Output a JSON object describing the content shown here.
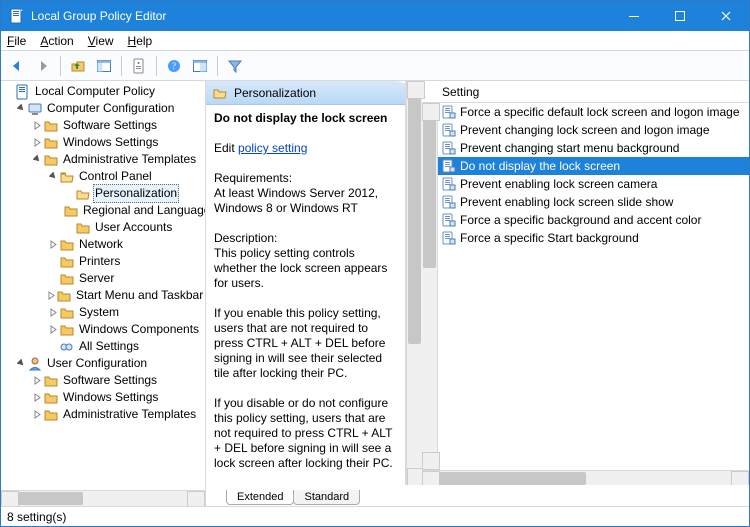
{
  "window": {
    "title": "Local Group Policy Editor"
  },
  "menubar": {
    "file": "File",
    "action": "Action",
    "view": "View",
    "help": "Help"
  },
  "tree": {
    "root": "Local Computer Policy",
    "cc": "Computer Configuration",
    "cc_sw": "Software Settings",
    "cc_win": "Windows Settings",
    "cc_at": "Administrative Templates",
    "cp": "Control Panel",
    "cp_pers": "Personalization",
    "cp_reg": "Regional and Language Options",
    "cp_ua": "User Accounts",
    "net": "Network",
    "prn": "Printers",
    "srv": "Server",
    "sm": "Start Menu and Taskbar",
    "sys": "System",
    "wc": "Windows Components",
    "alls": "All Settings",
    "uc": "User Configuration",
    "uc_sw": "Software Settings",
    "uc_win": "Windows Settings",
    "uc_at": "Administrative Templates"
  },
  "detail": {
    "heading": "Personalization",
    "title": "Do not display the lock screen",
    "edit_prefix": "Edit ",
    "edit_link": "policy setting",
    "req_label": "Requirements:",
    "req_text": "At least Windows Server 2012, Windows 8 or Windows RT",
    "desc_label": "Description:",
    "desc_text": "This policy setting controls whether the lock screen appears for users.",
    "p1": "If you enable this policy setting, users that are not required to press CTRL + ALT + DEL before signing in will see their selected tile after locking their PC.",
    "p2": "If you disable or do not configure this policy setting, users that are not required to press CTRL + ALT + DEL before signing in will see a lock screen after locking their PC."
  },
  "list": {
    "column": "Setting",
    "items": [
      "Force a specific default lock screen and logon image",
      "Prevent changing lock screen and logon image",
      "Prevent changing start menu background",
      "Do not display the lock screen",
      "Prevent enabling lock screen camera",
      "Prevent enabling lock screen slide show",
      "Force a specific background and accent color",
      "Force a specific Start background"
    ],
    "selected_index": 3
  },
  "tabs": {
    "extended": "Extended",
    "standard": "Standard"
  },
  "status": "8 setting(s)"
}
